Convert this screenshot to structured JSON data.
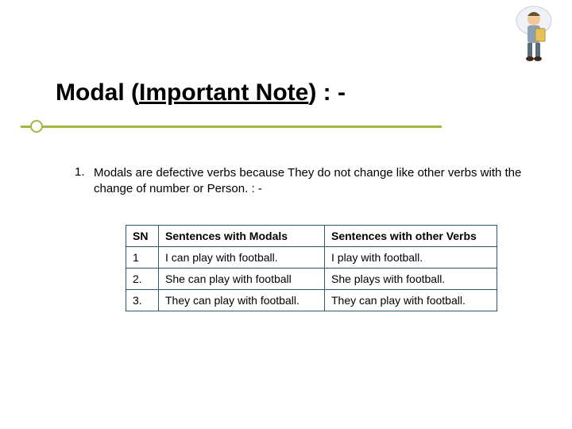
{
  "title": {
    "pre": "Modal (",
    "underline": "Important Note",
    "post": ") : -"
  },
  "list_number": "1.",
  "body": "Modals are defective verbs because They do not change like other verbs with the change of number or Person. : -",
  "table": {
    "headers": {
      "sn": "SN",
      "modals": "Sentences with Modals",
      "other": "Sentences with other Verbs"
    },
    "rows": [
      {
        "sn": "1",
        "modals": "I can play with football.",
        "other": "I play with football."
      },
      {
        "sn": "2.",
        "modals": "She can play with football",
        "other": "She plays with football."
      },
      {
        "sn": "3.",
        "modals": "They can play with football.",
        "other": "They can play with football."
      }
    ]
  }
}
